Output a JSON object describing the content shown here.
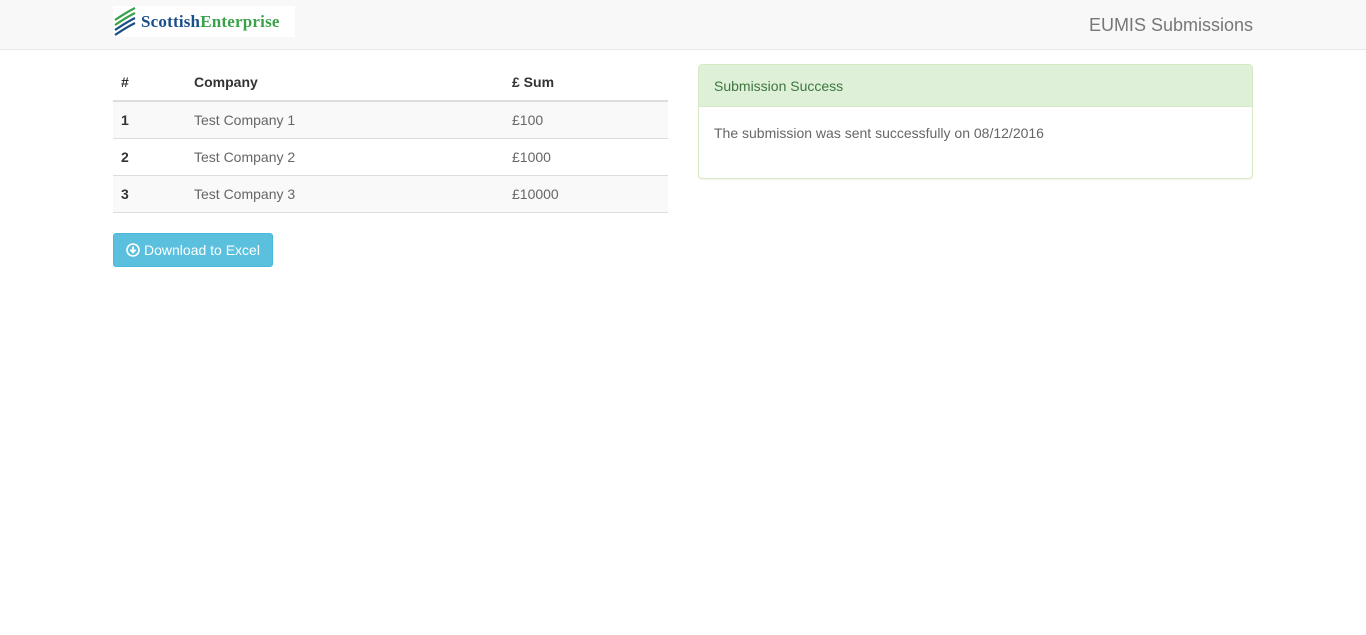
{
  "header": {
    "logo": {
      "word1": "Scottish",
      "word2": "Enterprise",
      "colors": {
        "word1": "#1b4f8a",
        "word2": "#3aa34a"
      }
    },
    "title": "EUMIS Submissions"
  },
  "table": {
    "columns": [
      "#",
      "Company",
      "£ Sum"
    ],
    "rows": [
      {
        "num": "1",
        "company": "Test Company 1",
        "sum": "£100"
      },
      {
        "num": "2",
        "company": "Test Company 2",
        "sum": "£1000"
      },
      {
        "num": "3",
        "company": "Test Company 3",
        "sum": "£10000"
      }
    ]
  },
  "download_button": {
    "label": "Download to Excel",
    "icon": "download-circle-icon",
    "color": "#5bc0de"
  },
  "panel": {
    "heading": "Submission Success",
    "body": "The submission was sent successfully on 08/12/2016",
    "colors": {
      "heading_bg": "#dff0d8",
      "heading_text": "#3c763d"
    }
  }
}
